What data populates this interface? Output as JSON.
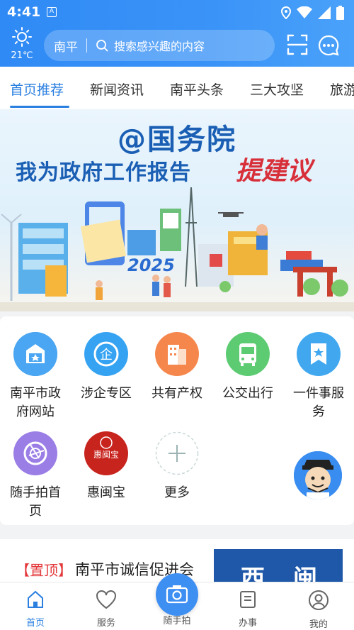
{
  "status": {
    "time": "4:41",
    "a_badge": "A"
  },
  "header": {
    "weather_temp": "21℃",
    "search_city": "南平",
    "search_placeholder": "搜索感兴趣的内容"
  },
  "tabs": [
    "首页推荐",
    "新闻资讯",
    "南平头条",
    "三大攻坚",
    "旅游"
  ],
  "banner": {
    "line1": "@国务院",
    "line2": "我为政府工作报告",
    "line3": "提建议",
    "year": "2025"
  },
  "services": [
    {
      "label": "南平市政府网站",
      "icon": "gov-site-icon",
      "color": "#3f9cf0"
    },
    {
      "label": "涉企专区",
      "icon": "enterprise-icon",
      "color": "#35a3f2"
    },
    {
      "label": "共有产权",
      "icon": "property-icon",
      "color": "#f5874c"
    },
    {
      "label": "公交出行",
      "icon": "bus-icon",
      "color": "#5ccb72"
    },
    {
      "label": "一件事服务",
      "icon": "one-thing-icon",
      "color": "#41a8f0"
    },
    {
      "label": "随手拍首页",
      "icon": "camera-shutter-icon",
      "color": "#9a7ee6"
    },
    {
      "label": "惠闽宝",
      "icon": "huiminbao-icon",
      "color": "#c8241e",
      "icon_text": "惠闽宝"
    },
    {
      "label": "更多",
      "icon": "plus-icon",
      "color": "#ffffff"
    }
  ],
  "news": {
    "tag": "【置顶】",
    "title": "南平市诚信促进会",
    "thumb_text": [
      "西",
      "闽"
    ]
  },
  "bottom_nav": [
    {
      "label": "首页",
      "icon": "home-icon",
      "active": true
    },
    {
      "label": "服务",
      "icon": "heart-icon",
      "active": false
    },
    {
      "label": "随手拍",
      "icon": "camera-icon",
      "active": false
    },
    {
      "label": "办事",
      "icon": "document-icon",
      "active": false
    },
    {
      "label": "我的",
      "icon": "user-icon",
      "active": false
    }
  ],
  "colors": {
    "primary": "#2f8af5",
    "accent_red": "#e4393c",
    "active_tab": "#2a7fe0"
  }
}
